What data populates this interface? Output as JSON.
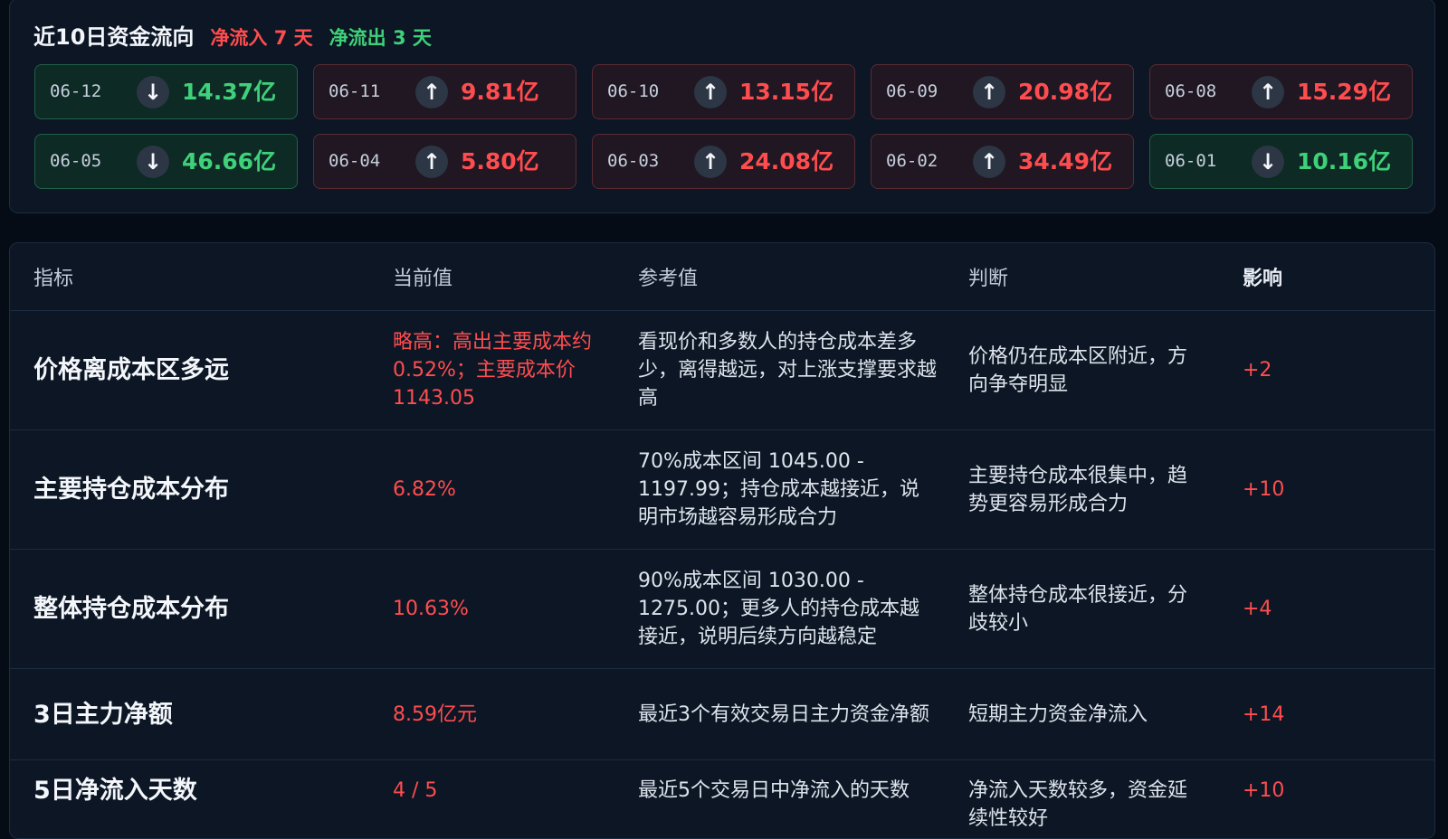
{
  "flow": {
    "title": "近10日资金流向",
    "inflow_label": "净流入 7 天",
    "outflow_label": "净流出 3 天",
    "days": [
      {
        "date": "06-12",
        "dir": "out",
        "arrow": "↓",
        "amount": "14.37亿"
      },
      {
        "date": "06-11",
        "dir": "in",
        "arrow": "↑",
        "amount": "9.81亿"
      },
      {
        "date": "06-10",
        "dir": "in",
        "arrow": "↑",
        "amount": "13.15亿"
      },
      {
        "date": "06-09",
        "dir": "in",
        "arrow": "↑",
        "amount": "20.98亿"
      },
      {
        "date": "06-08",
        "dir": "in",
        "arrow": "↑",
        "amount": "15.29亿"
      },
      {
        "date": "06-05",
        "dir": "out",
        "arrow": "↓",
        "amount": "46.66亿"
      },
      {
        "date": "06-04",
        "dir": "in",
        "arrow": "↑",
        "amount": "5.80亿"
      },
      {
        "date": "06-03",
        "dir": "in",
        "arrow": "↑",
        "amount": "24.08亿"
      },
      {
        "date": "06-02",
        "dir": "in",
        "arrow": "↑",
        "amount": "34.49亿"
      },
      {
        "date": "06-01",
        "dir": "out",
        "arrow": "↓",
        "amount": "10.16亿"
      }
    ]
  },
  "table": {
    "headers": {
      "indicator": "指标",
      "current": "当前值",
      "reference": "参考值",
      "judgment": "判断",
      "impact": "影响"
    },
    "rows": [
      {
        "indicator": "价格离成本区多远",
        "current": "略高：高出主要成本约0.52%；主要成本价1143.05",
        "reference": "看现价和多数人的持仓成本差多少，离得越远，对上涨支撑要求越高",
        "judgment": "价格仍在成本区附近，方向争夺明显",
        "impact": "+2"
      },
      {
        "indicator": "主要持仓成本分布",
        "current": "6.82%",
        "reference": "70%成本区间 1045.00 - 1197.99；持仓成本越接近，说明市场越容易形成合力",
        "judgment": "主要持仓成本很集中，趋势更容易形成合力",
        "impact": "+10"
      },
      {
        "indicator": "整体持仓成本分布",
        "current": "10.63%",
        "reference": "90%成本区间 1030.00 - 1275.00；更多人的持仓成本越接近，说明后续方向越稳定",
        "judgment": "整体持仓成本很接近，分歧较小",
        "impact": "+4"
      },
      {
        "indicator": "3日主力净额",
        "current": "8.59亿元",
        "reference": "最近3个有效交易日主力资金净额",
        "judgment": "短期主力资金净流入",
        "impact": "+14"
      },
      {
        "indicator": "5日净流入天数",
        "current": "4 / 5",
        "reference": "最近5个交易日中净流入的天数",
        "judgment": "净流入天数较多，资金延续性较好",
        "impact": "+10"
      }
    ]
  },
  "colors": {
    "inflow": "#ff4d4f",
    "outflow": "#3fd17a",
    "background": "#060c16",
    "panel": "#0c1624"
  }
}
